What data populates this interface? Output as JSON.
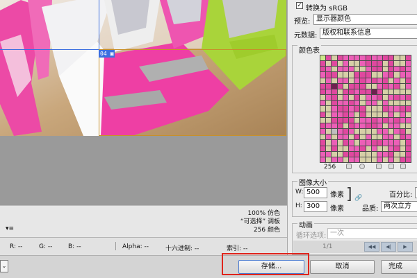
{
  "preview": {
    "slice_tag": "04"
  },
  "info": {
    "line1": "100% 仿色",
    "line2": "“可选择” 调板",
    "line3": "256 颜色"
  },
  "status": {
    "r": "R: --",
    "g": "G: --",
    "b": "B: --",
    "alpha": "Alpha: --",
    "hex": "十六进制: --",
    "index": "索引: --"
  },
  "panel": {
    "convert_srgb": "转换为 sRGB",
    "preview_label": "预览:",
    "preview_value": "显示器颜色",
    "metadata_label": "元数据:",
    "metadata_value": "版权和联系信息",
    "color_table_label": "颜色表",
    "color_count": "256",
    "image_size_label": "图像大小",
    "w_label": "W:",
    "w_value": "500",
    "h_label": "H:",
    "h_value": "300",
    "px_unit": "像素",
    "percent_label": "百分比:",
    "quality_label": "品质:",
    "quality_value": "两次立方",
    "animation_label": "动画",
    "loop_label": "循环选项:",
    "loop_value": "一次",
    "frame_counter": "1/1"
  },
  "buttons": {
    "save": "存储...",
    "cancel": "取消",
    "done": "完成"
  },
  "colors": {
    "palette": [
      "#e0489f",
      "#c4c4c4",
      "#8e2a6c",
      "#b8d86a",
      "#d9d9ef",
      "#f27bc4",
      "#6c5a5a",
      "#a8a8c4",
      "#ec5fb7",
      "#bfbfbf",
      "#dcdcdc",
      "#9e3a84",
      "#cde88a",
      "#b56496",
      "#7d7d8d",
      "#f5a6d8",
      "#d6cfa7",
      "#6f1f4f",
      "#eaeaea",
      "#a25c7c",
      "#c078a8",
      "#95b848",
      "#e7d1df",
      "#58484c"
    ],
    "accent_highlight": "#e0241b",
    "slice_blue": "#3c6fe0"
  }
}
